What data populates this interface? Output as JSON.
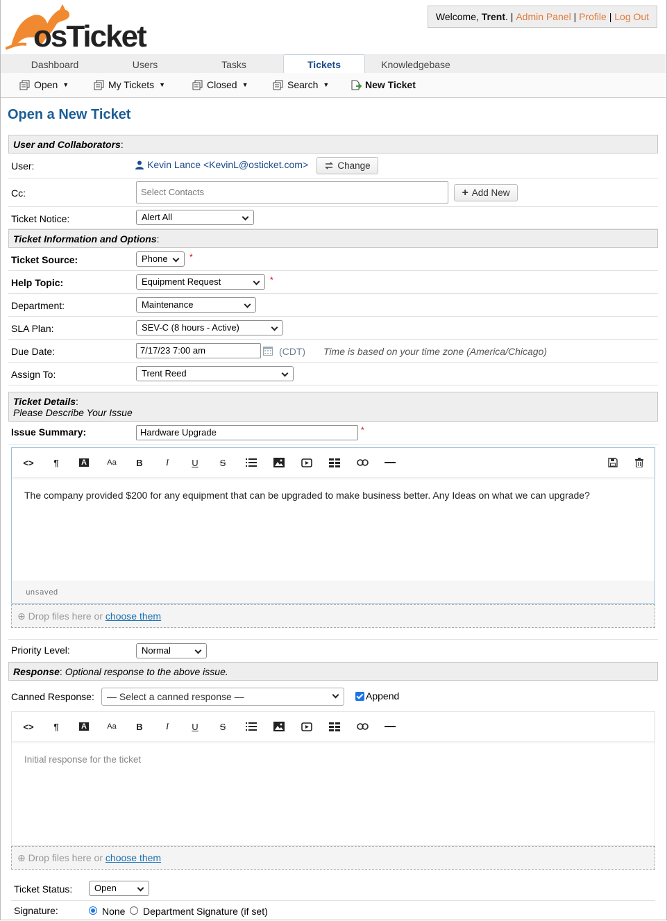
{
  "header": {
    "logo_text": "osTicket",
    "welcome_prefix": "Welcome,",
    "user_name": "Trent",
    "admin_panel": "Admin Panel",
    "profile": "Profile",
    "logout": "Log Out",
    "sep": "|",
    "accent": "#e07a3a"
  },
  "nav": {
    "tabs": [
      "Dashboard",
      "Users",
      "Tasks",
      "Tickets",
      "Knowledgebase"
    ],
    "active": "Tickets"
  },
  "subnav": {
    "open": "Open",
    "my_tickets": "My Tickets",
    "closed": "Closed",
    "search": "Search",
    "new_ticket": "New Ticket"
  },
  "page": {
    "title": "Open a New Ticket"
  },
  "user_section": {
    "header": "User and Collaborators",
    "user_label": "User:",
    "user_value": "Kevin Lance <KevinL@osticket.com>",
    "change_btn": "Change",
    "cc_label": "Cc:",
    "cc_placeholder": "Select Contacts",
    "add_new_btn": "Add New",
    "notice_label": "Ticket Notice:",
    "notice_value": "Alert All"
  },
  "ticket_info": {
    "header": "Ticket Information and Options",
    "source_label": "Ticket Source:",
    "source_value": "Phone",
    "help_label": "Help Topic:",
    "help_value": "Equipment Request",
    "dept_label": "Department:",
    "dept_value": "Maintenance",
    "sla_label": "SLA Plan:",
    "sla_value": "SEV-C (8 hours - Active)",
    "due_label": "Due Date:",
    "due_value": "7/17/23 7:00 am",
    "tz": "(CDT)",
    "tz_note": "Time is based on your time zone (America/Chicago)",
    "assign_label": "Assign To:",
    "assign_value": "Trent Reed",
    "required": "*"
  },
  "details": {
    "header": "Ticket Details",
    "subheader": "Please Describe Your Issue",
    "summary_label": "Issue Summary:",
    "summary_value": "Hardware Upgrade",
    "body": "The company provided $200 for any equipment that can be upgraded to make business better. Any Ideas on what we can upgrade?",
    "unsaved": "unsaved",
    "drop_text": "Drop files here or",
    "drop_link": "choose them",
    "priority_label": "Priority Level:",
    "priority_value": "Normal"
  },
  "response": {
    "header": "Response",
    "subheader": "Optional response to the above issue.",
    "canned_label": "Canned Response:",
    "canned_value": "— Select a canned response —",
    "append": "Append",
    "placeholder": "Initial response for the ticket",
    "drop_text": "Drop files here or",
    "drop_link": "choose them",
    "status_label": "Ticket Status:",
    "status_value": "Open",
    "signature_label": "Signature:",
    "sig_none": "None",
    "sig_dept": "Department Signature (if set)"
  }
}
